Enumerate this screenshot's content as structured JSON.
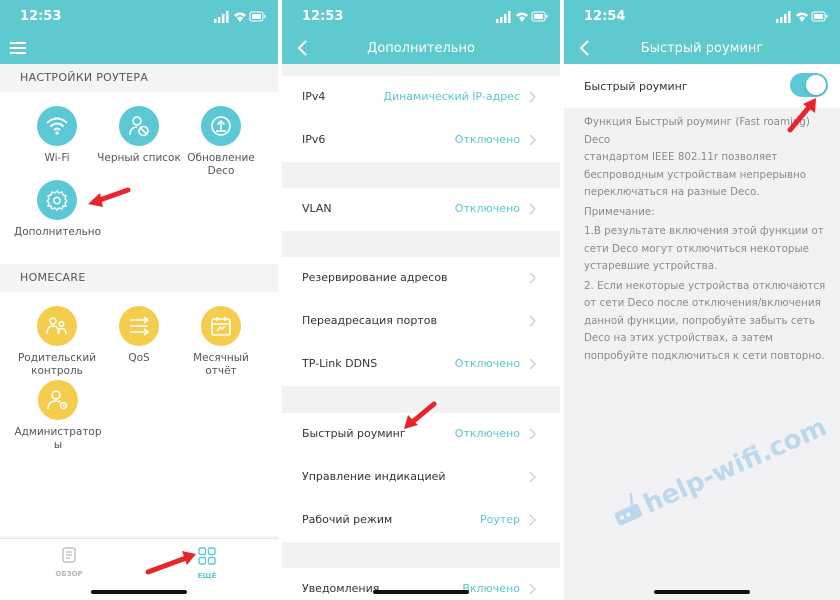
{
  "screen1": {
    "time": "12:53",
    "section_router": "НАСТРОЙКИ РОУТЕРА",
    "tiles_router": [
      {
        "label": "Wi-Fi",
        "icon": "wifi-icon"
      },
      {
        "label": "Черный список",
        "icon": "blocked-user-icon"
      },
      {
        "label": "Обновление Deco",
        "icon": "update-icon"
      },
      {
        "label": "Дополнительно",
        "icon": "gear-icon"
      }
    ],
    "section_homecare": "HOMECARE",
    "tiles_homecare": [
      {
        "label": "Родительский контроль",
        "icon": "parental-control-icon"
      },
      {
        "label": "QoS",
        "icon": "qos-icon"
      },
      {
        "label": "Месячный отчёт",
        "icon": "calendar-report-icon"
      },
      {
        "label": "Администраторы",
        "icon": "admin-icon"
      }
    ],
    "tabs": [
      {
        "label": "ОБЗОР",
        "icon": "overview-icon"
      },
      {
        "label": "ЕЩЁ",
        "icon": "more-grid-icon"
      }
    ]
  },
  "screen2": {
    "time": "12:53",
    "title": "Дополнительно",
    "rows": [
      {
        "label": "IPv4",
        "value": "Динамический IP-адрес"
      },
      {
        "label": "IPv6",
        "value": "Отключено"
      },
      {
        "label": "VLAN",
        "value": "Отключено"
      },
      {
        "label": "Резервирование адресов",
        "value": ""
      },
      {
        "label": "Переадресация портов",
        "value": ""
      },
      {
        "label": "TP-Link DDNS",
        "value": "Отключено"
      },
      {
        "label": "Быстрый роуминг",
        "value": "Отключено"
      },
      {
        "label": "Управление индикацией",
        "value": ""
      },
      {
        "label": "Рабочий режим",
        "value": "Роутер"
      },
      {
        "label": "Уведомления",
        "value": "Включено"
      }
    ]
  },
  "screen3": {
    "time": "12:54",
    "title": "Быстрый роуминг",
    "toggle_label": "Быстрый роуминг",
    "toggle_on": true,
    "description_lines": [
      "Функция Быстрый роуминг (Fast roaming) Deco",
      "стандартом IEEE 802.11r позволяет",
      "беспроводным устройствам непрерывно",
      "переключаться на разные Deco."
    ],
    "note_title": "Примечание:",
    "note1_lines": [
      "1.В результате включения этой функции от",
      "сети Deco могут отключиться некоторые",
      "устаревшие устройства."
    ],
    "note2_lines": [
      "2. Если некоторые устройства отключаются",
      "от сети Deco после отключения/включения",
      "данной функции, попробуйте забыть сеть",
      "Deco на этих устройствах, а затем",
      "попробуйте подключиться к сети повторно."
    ]
  },
  "watermark": "help-wifi.com",
  "colors": {
    "accent": "#5fc9d0",
    "tile_teal": "#5cc8d6",
    "tile_yellow": "#f5cd4c",
    "value_text": "#59c6cd",
    "arrow": "#e8252a"
  }
}
